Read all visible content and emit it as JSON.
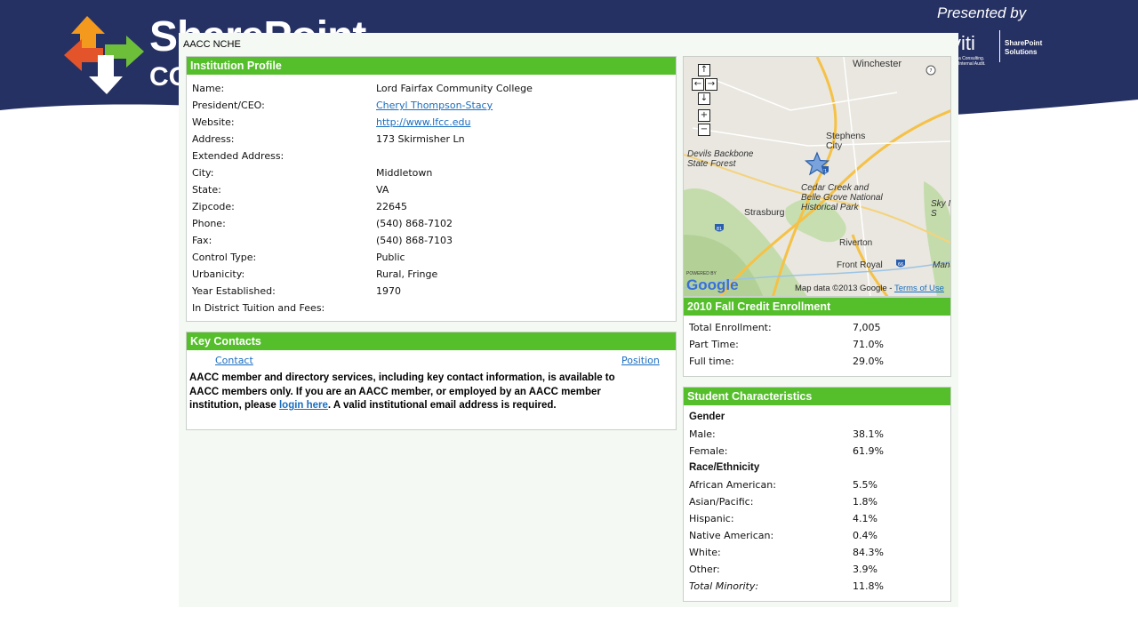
{
  "slide": {
    "brand_text": "SharePoint",
    "brand_sub": "CO",
    "presented_by": "Presented by",
    "sponsor_name": "viti",
    "sponsor_tagline": "SharePoint\nSolutions",
    "sponsor_small": "a Consulting.\nInternal Audit."
  },
  "window": {
    "title": "AACC NCHE"
  },
  "institution_profile": {
    "header": "Institution Profile",
    "rows": [
      {
        "label": "Name:",
        "value": "Lord Fairfax Community College",
        "link": false
      },
      {
        "label": "President/CEO:",
        "value": "Cheryl Thompson-Stacy",
        "link": true
      },
      {
        "label": "Website:",
        "value": "http://www.lfcc.edu",
        "link": true
      },
      {
        "label": "Address:",
        "value": "173 Skirmisher Ln",
        "link": false
      },
      {
        "label": "Extended Address:",
        "value": "",
        "link": false
      },
      {
        "label": "City:",
        "value": "Middletown",
        "link": false
      },
      {
        "label": "State:",
        "value": "VA",
        "link": false
      },
      {
        "label": "Zipcode:",
        "value": "22645",
        "link": false
      },
      {
        "label": "Phone:",
        "value": "(540) 868-7102",
        "link": false
      },
      {
        "label": "Fax:",
        "value": "(540) 868-7103",
        "link": false
      },
      {
        "label": "Control Type:",
        "value": "Public",
        "link": false
      },
      {
        "label": "Urbanicity:",
        "value": "Rural, Fringe",
        "link": false
      },
      {
        "label": "Year Established:",
        "value": "1970",
        "link": false
      },
      {
        "label": "In District Tuition and Fees:",
        "value": "",
        "link": false
      }
    ]
  },
  "key_contacts": {
    "header": "Key Contacts",
    "col_contact": "Contact",
    "col_position": "Position",
    "notice_before": "AACC member and directory services, including key contact information, is available to AACC members only. If you are an AACC member, or employed by an AACC member institution, please ",
    "notice_link": "login here",
    "notice_after": ". A valid institutional email address is required."
  },
  "map": {
    "labels": {
      "winchester": "Winchester",
      "stephens_city": "Stephens\nCity",
      "devils_backbone": "Devils Backbone\nState Forest",
      "cedar_creek": "Cedar Creek and\nBelle Grove National\nHistorical Park",
      "strasburg": "Strasburg",
      "sky_m": "Sky M\nS",
      "riverton": "Riverton",
      "front_royal": "Front Royal",
      "mana": "Mana"
    },
    "route_shields": [
      "81",
      "81",
      "66",
      "7"
    ],
    "powered_by": "POWERED BY",
    "google": "Google",
    "map_data": "Map data ©2013 Google - ",
    "terms": "Terms of Use",
    "controls": [
      "↑",
      "←",
      "→",
      "↓",
      "+",
      "−"
    ]
  },
  "enrollment": {
    "header": "2010 Fall Credit Enrollment",
    "rows": [
      {
        "label": "Total Enrollment:",
        "value": "7,005"
      },
      {
        "label": "Part Time:",
        "value": "71.0%"
      },
      {
        "label": "Full time:",
        "value": "29.0%"
      }
    ]
  },
  "characteristics": {
    "header": "Student Characteristics",
    "gender_title": "Gender",
    "gender": [
      {
        "label": "Male:",
        "value": "38.1%"
      },
      {
        "label": "Female:",
        "value": "61.9%"
      }
    ],
    "race_title": "Race/Ethnicity",
    "race": [
      {
        "label": "African American:",
        "value": "5.5%"
      },
      {
        "label": "Asian/Pacific:",
        "value": "1.8%"
      },
      {
        "label": "Hispanic:",
        "value": "4.1%"
      },
      {
        "label": "Native American:",
        "value": "0.4%"
      },
      {
        "label": "White:",
        "value": "84.3%"
      },
      {
        "label": "Other:",
        "value": "3.9%"
      },
      {
        "label": "Total Minority:",
        "value": "11.8%"
      }
    ]
  },
  "colors": {
    "slide_navy": "#263163",
    "panel_green": "#55be2b",
    "link_blue": "#1a6dbf"
  }
}
